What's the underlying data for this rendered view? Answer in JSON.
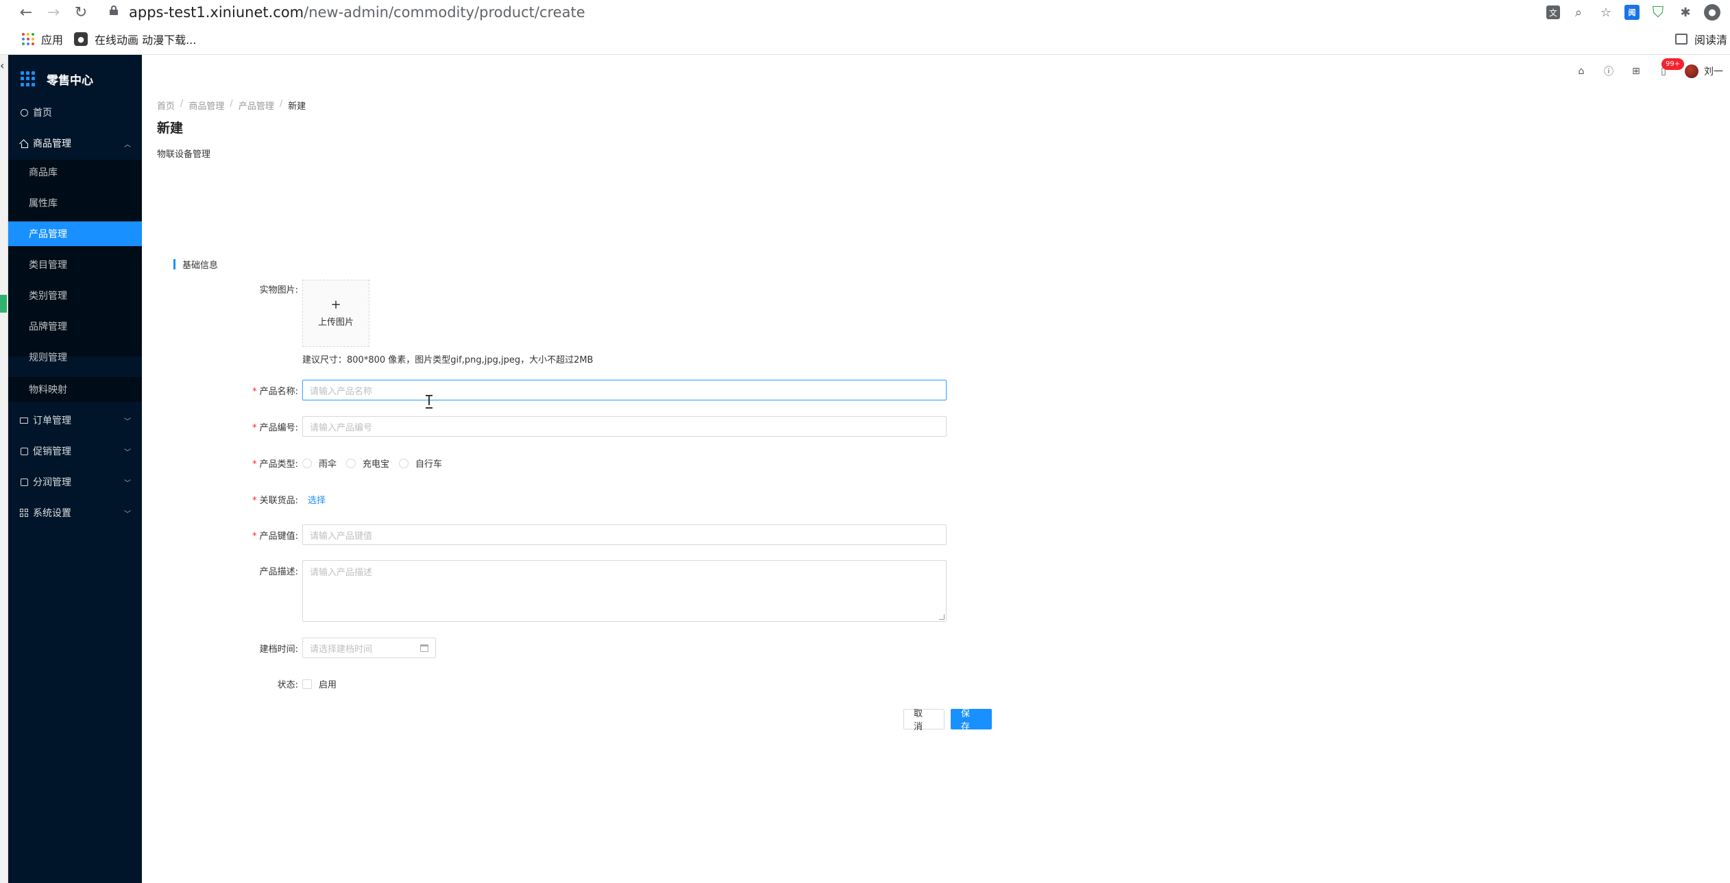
{
  "browser": {
    "url_host": "apps-test1.xiniunet.com",
    "url_path": "/new-admin/commodity/product/create",
    "bookmarks": [
      {
        "label": "应用"
      },
      {
        "label": "在线动画 动漫下载..."
      }
    ],
    "reading_list": "阅读清"
  },
  "sidebar": {
    "title": "零售中心",
    "items": [
      {
        "label": "首页",
        "icon": "clock-icon"
      },
      {
        "label": "商品管理",
        "icon": "home-icon",
        "expanded": true
      },
      {
        "label": "订单管理",
        "icon": "mail-icon"
      },
      {
        "label": "促销管理",
        "icon": "calendar-icon"
      },
      {
        "label": "分润管理",
        "icon": "square-icon"
      },
      {
        "label": "系统设置",
        "icon": "grid-icon"
      }
    ],
    "submenu": [
      {
        "label": "商品库"
      },
      {
        "label": "属性库"
      },
      {
        "label": "产品管理",
        "active": true
      },
      {
        "label": "类目管理"
      },
      {
        "label": "类别管理"
      },
      {
        "label": "品牌管理"
      },
      {
        "label": "规则管理"
      },
      {
        "label": "物料映射"
      }
    ]
  },
  "topbar": {
    "badge": "99+",
    "user_name": "刘一"
  },
  "breadcrumb": [
    "首页",
    "商品管理",
    "产品管理",
    "新建"
  ],
  "page": {
    "title": "新建",
    "subtitle": "物联设备管理"
  },
  "form": {
    "section_title": "基础信息",
    "image_label": "实物图片:",
    "upload_text": "上传图片",
    "upload_hint": "建议尺寸：800*800 像素，图片类型gif,png,jpg,jpeg，大小不超过2MB",
    "name_label": "产品名称:",
    "name_placeholder": "请输入产品名称",
    "code_label": "产品编号:",
    "code_placeholder": "请输入产品编号",
    "type_label": "产品类型:",
    "type_options": [
      "雨伞",
      "充电宝",
      "自行车"
    ],
    "goods_label": "关联货品:",
    "goods_link": "选择",
    "key_label": "产品键值:",
    "key_placeholder": "请输入产品键值",
    "desc_label": "产品描述:",
    "desc_placeholder": "请输入产品描述",
    "time_label": "建档时间:",
    "time_placeholder": "请选择建档时间",
    "status_label": "状态:",
    "status_option": "启用",
    "cancel": "取 消",
    "save": "保 存"
  },
  "colors": {
    "primary": "#1890ff",
    "sidebar_bg": "#001529",
    "required": "#f5222d"
  }
}
